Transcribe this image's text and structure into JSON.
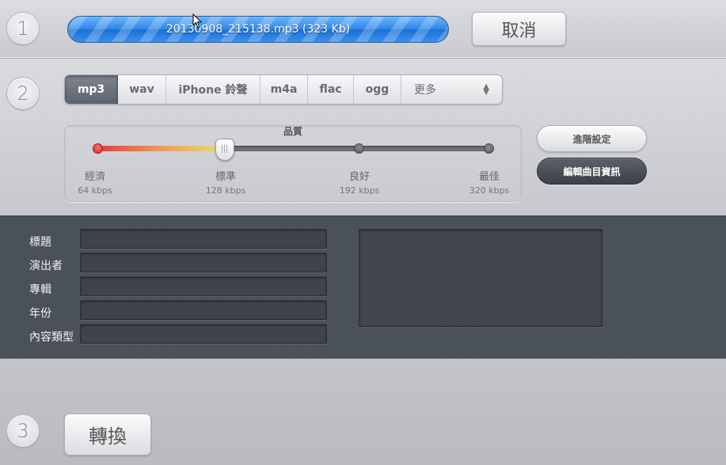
{
  "steps": {
    "one": "1",
    "two": "2",
    "three": "3"
  },
  "progress": {
    "filename": "20130908_215138.mp3 (323 Kb)",
    "percent": 100,
    "color": "#2d86e6"
  },
  "buttons": {
    "cancel": "取消",
    "advanced_settings": "進階設定",
    "edit_track_info": "編輯曲目資訊",
    "convert": "轉換"
  },
  "format_tabs": [
    {
      "label": "mp3",
      "active": true
    },
    {
      "label": "wav",
      "active": false
    },
    {
      "label": "iPhone 鈴聲",
      "active": false
    },
    {
      "label": "m4a",
      "active": false
    },
    {
      "label": "flac",
      "active": false
    },
    {
      "label": "ogg",
      "active": false
    }
  ],
  "format_more": "更多",
  "quality": {
    "title": "品質",
    "selected_index": 1,
    "levels": [
      {
        "label": "經濟",
        "rate": "64 kbps"
      },
      {
        "label": "標準",
        "rate": "128 kbps"
      },
      {
        "label": "良好",
        "rate": "192 kbps"
      },
      {
        "label": "最佳",
        "rate": "320 kbps"
      }
    ]
  },
  "metadata": {
    "fields": [
      {
        "label": "標題",
        "value": ""
      },
      {
        "label": "演出者",
        "value": ""
      },
      {
        "label": "專輯",
        "value": ""
      },
      {
        "label": "年份",
        "value": ""
      },
      {
        "label": "內容類型",
        "value": ""
      }
    ]
  }
}
